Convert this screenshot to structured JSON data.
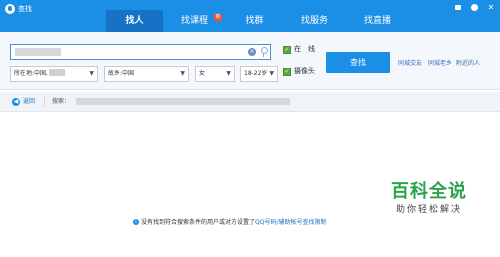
{
  "window": {
    "title": "查找"
  },
  "tabs": [
    {
      "label": "找人",
      "active": true
    },
    {
      "label": "找课程",
      "badge": "新"
    },
    {
      "label": "找群"
    },
    {
      "label": "找服务"
    },
    {
      "label": "找直播"
    }
  ],
  "search": {
    "keyword_value": "",
    "online_label": "在　线",
    "online_checked": true,
    "camera_label": "摄像头",
    "camera_checked": true,
    "location": "所在地:中国,",
    "hometown": "故乡:中国",
    "gender": "女",
    "age": "18-22岁",
    "search_button": "查找",
    "quick_links": [
      "同城交友",
      "同城老乡",
      "附近的人"
    ]
  },
  "breadcrumb": {
    "back_label": "返回",
    "search_label": "搜索："
  },
  "results": {
    "empty_message": "没有找到符合搜索条件的用户或对方设置了",
    "empty_link": "QQ号码/辅助帐号查找限制"
  },
  "watermark": {
    "main": "百科全说",
    "sub": "助你轻松解决"
  },
  "colors": {
    "titlebar": "#1b8ee6",
    "active_tab": "#1572c4",
    "button": "#1b8ee6",
    "check": "#5aa83a",
    "watermark": "#2aa34a"
  }
}
